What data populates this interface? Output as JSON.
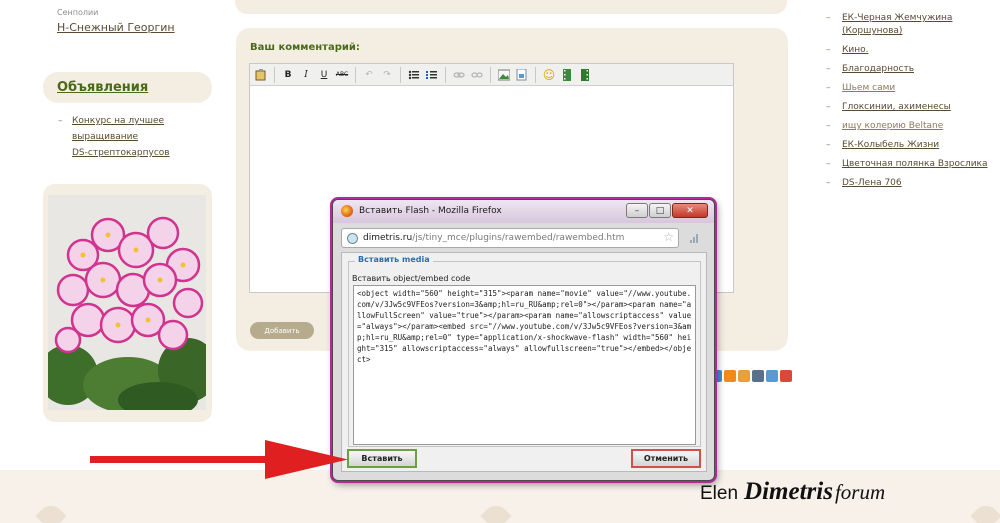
{
  "left_column": {
    "prev_author": "Сенполии",
    "prev_item": "Н-Снежный Георгин",
    "ads_title": "Объявления",
    "ads_items": [
      "Конкурс на лучшее",
      "выращивание",
      "DS-стрептокарпусов"
    ]
  },
  "comment_form": {
    "title": "Ваш комментарий:",
    "submit_label": "Добавить",
    "toolbar_icons": [
      "paste-icon",
      "bold-icon",
      "italic-icon",
      "underline-icon",
      "strikethrough-icon",
      "undo-icon",
      "redo-icon",
      "bullet-list-icon",
      "numbered-list-icon",
      "link-icon",
      "unlink-icon",
      "image-icon",
      "image-insert-icon",
      "emoticon-icon",
      "media-icon",
      "flash-icon"
    ],
    "toolbar_glyphs": {
      "bold": "B",
      "italic": "I",
      "underline": "U",
      "strike": "ABC",
      "undo": "↶",
      "redo": "↷",
      "smiley": "☺"
    }
  },
  "right_column": {
    "items": [
      "ЕК-Черная Жемчужина (Коршунова)",
      "Кино.",
      "Благодарность",
      "Шьем сами",
      "Глоксинии, ахименесы",
      "ищу колерию Beltane",
      "ЕК-Колыбель Жизни",
      "Цветочная полянка Взрослика",
      "DS-Лена 706"
    ]
  },
  "popup": {
    "window_title": "Вставить Flash - Mozilla Firefox",
    "url_domain": "dimetris.ru",
    "url_path": "/js/tiny_mce/plugins/rawembed/rawembed.htm",
    "legend": "Вставить media",
    "field_label": "Вставить object/embed code",
    "code": "<object width=\"560\" height=\"315\"><param name=\"movie\" value=\"//www.youtube.com/v/3Jw5c9VFEos?version=3&amp;hl=ru_RU&amp;rel=0\"></param><param name=\"allowFullScreen\" value=\"true\"></param><param name=\"allowscriptaccess\" value=\"always\"></param><embed src=\"//www.youtube.com/v/3Jw5c9VFEos?version=3&amp;hl=ru_RU&amp;rel=0\" type=\"application/x-shockwave-flash\" width=\"560\" height=\"315\" allowscriptaccess=\"always\" allowfullscreen=\"true\"></embed></object>",
    "insert_label": "Вставить",
    "cancel_label": "Отменить",
    "controls": {
      "minimize": "–",
      "maximize": "□",
      "close": "✕",
      "bookmark": "☆"
    }
  },
  "watermark": {
    "prefix": "Elen",
    "brand": "Dimetris",
    "suffix": "forum"
  },
  "colors": {
    "accent_green": "#4a6a1a",
    "panel_beige": "#f4ede2",
    "popup_frame": "#b02a9a",
    "arrow_red": "#e02020"
  }
}
